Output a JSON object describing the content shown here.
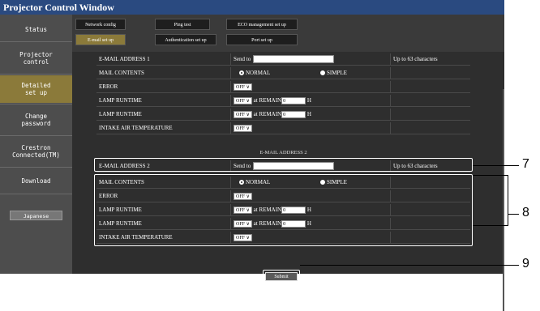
{
  "window": {
    "title": "Projector Control Window"
  },
  "sidebar": {
    "items": [
      {
        "label": "Status"
      },
      {
        "label": "Projector\ncontrol"
      },
      {
        "label": "Detailed\nset up"
      },
      {
        "label": "Change\npassword"
      },
      {
        "label": "Crestron\nConnected(TM)"
      },
      {
        "label": "Download"
      }
    ],
    "language_button": "Japanese"
  },
  "tabs": {
    "row1": [
      "Network config",
      "Ping test",
      "ECO management set up"
    ],
    "row2": [
      "E-mail set up",
      "Authentication set up",
      "Port set up"
    ]
  },
  "section1": {
    "rows": [
      {
        "label": "E-MAIL ADDRESS 1",
        "prefix": "Send to",
        "value": "",
        "note": "Up to 63 characters"
      },
      {
        "label": "MAIL CONTENTS",
        "opt_normal": "NORMAL",
        "opt_simple": "SIMPLE"
      },
      {
        "label": "ERROR",
        "select": "OFF"
      },
      {
        "label": "LAMP RUNTIME",
        "select": "OFF",
        "remain_label": "at REMAIN",
        "remain_value": "0",
        "unit": "H"
      },
      {
        "label": "LAMP RUNTIME",
        "select": "OFF",
        "remain_label": "at REMAIN",
        "remain_value": "0",
        "unit": "H"
      },
      {
        "label": "INTAKE AIR TEMPERATURE",
        "select": "OFF"
      }
    ]
  },
  "section2": {
    "header": "E-MAIL ADDRESS 2",
    "rows": [
      {
        "label": "E-MAIL ADDRESS 2",
        "prefix": "Send to",
        "value": "",
        "note": "Up to 63 characters"
      },
      {
        "label": "MAIL CONTENTS",
        "opt_normal": "NORMAL",
        "opt_simple": "SIMPLE"
      },
      {
        "label": "ERROR",
        "select": "OFF"
      },
      {
        "label": "LAMP RUNTIME",
        "select": "OFF",
        "remain_label": "at REMAIN",
        "remain_value": "0",
        "unit": "H"
      },
      {
        "label": "LAMP RUNTIME",
        "select": "OFF",
        "remain_label": "at REMAIN",
        "remain_value": "0",
        "unit": "H"
      },
      {
        "label": "INTAKE AIR TEMPERATURE",
        "select": "OFF"
      }
    ]
  },
  "submit_label": "Submit",
  "callouts": [
    "7",
    "8",
    "9"
  ],
  "chevron": "∨"
}
